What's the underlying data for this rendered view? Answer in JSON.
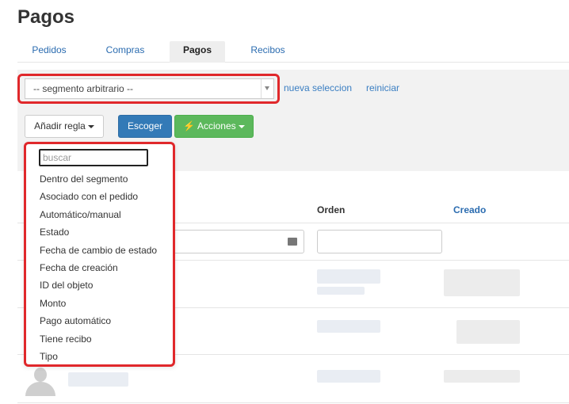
{
  "page": {
    "title": "Pagos"
  },
  "tabs": [
    {
      "label": "Pedidos",
      "active": false
    },
    {
      "label": "Compras",
      "active": false
    },
    {
      "label": "Pagos",
      "active": true
    },
    {
      "label": "Recibos",
      "active": false
    }
  ],
  "segment": {
    "selected": "-- segmento arbitrario --",
    "new_selection_link": "nueva seleccion",
    "reset_link": "reiniciar"
  },
  "toolbar": {
    "add_rule_label": "Añadir regla",
    "choose_label": "Escoger",
    "actions_label": "Acciones"
  },
  "table": {
    "columns": [
      "Orden",
      "Creado"
    ]
  },
  "dropdown": {
    "search_placeholder": "buscar",
    "items": [
      "Dentro del segmento",
      "Asociado con el pedido",
      "Automático/manual",
      "Estado",
      "Fecha de cambio de estado",
      "Fecha de creación",
      "ID del objeto",
      "Monto",
      "Pago automático",
      "Tiene recibo",
      "Tipo"
    ]
  },
  "colors": {
    "highlight": "#e0282b",
    "primary": "#337ab7",
    "success": "#5cb85c",
    "link": "#3a7ec2"
  }
}
